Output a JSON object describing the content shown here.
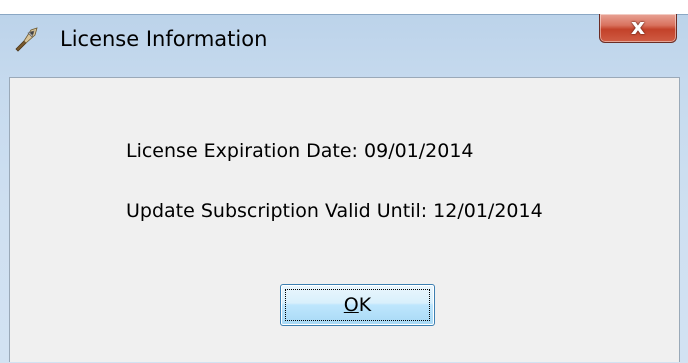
{
  "window": {
    "title": "License Information",
    "icon": "app-icon",
    "close_glyph": "x"
  },
  "info": {
    "expiration_label": "License Expiration Date:",
    "expiration_value": "09/01/2014",
    "subscription_label": "Update Subscription Valid Until:",
    "subscription_value": "12/01/2014"
  },
  "buttons": {
    "ok_mnemonic": "O",
    "ok_rest": "K"
  },
  "colors": {
    "frame": "#c6daee",
    "client": "#f0f0f0",
    "close_red": "#c3422a",
    "ok_border": "#3c7fb1"
  }
}
